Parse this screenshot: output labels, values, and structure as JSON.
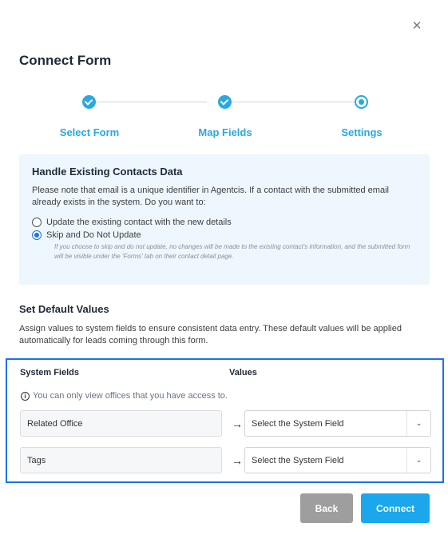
{
  "modal": {
    "close_icon": "close-icon",
    "title": "Connect Form"
  },
  "stepper": {
    "steps": [
      {
        "label": "Select Form",
        "state": "complete"
      },
      {
        "label": "Map Fields",
        "state": "complete"
      },
      {
        "label": "Settings",
        "state": "current"
      }
    ],
    "accent_color": "#27a9e1"
  },
  "existing_contacts": {
    "title": "Handle Existing Contacts Data",
    "description": "Please note that email is a unique identifier in Agentcis. If a contact with the submitted email already exists in the system. Do you want to:",
    "options": [
      {
        "label": "Update the existing contact with the new details",
        "selected": false
      },
      {
        "label": "Skip and Do Not Update",
        "selected": true
      }
    ],
    "note": "If you choose to skip and do not update, no changes will be made to the existing contact's information, and the submitted form will be visible under the 'Forms' tab on their contact detail page."
  },
  "defaults": {
    "title": "Set Default Values",
    "description": "Assign values to system fields to ensure consistent data entry. These default values will be applied automatically for leads coming through this form.",
    "columns": {
      "system_fields": "System Fields",
      "values": "Values"
    },
    "note": "You can only view offices that you have access to.",
    "rows": [
      {
        "field": "Related Office",
        "arrow": "→",
        "select_value": "Select the System Field"
      },
      {
        "field": "Tags",
        "arrow": "→",
        "select_value": "Select the System Field"
      }
    ]
  },
  "actions": {
    "back_label": "Back",
    "connect_label": "Connect",
    "back_color": "#9e9e9e",
    "connect_color": "#1aa7ec"
  }
}
